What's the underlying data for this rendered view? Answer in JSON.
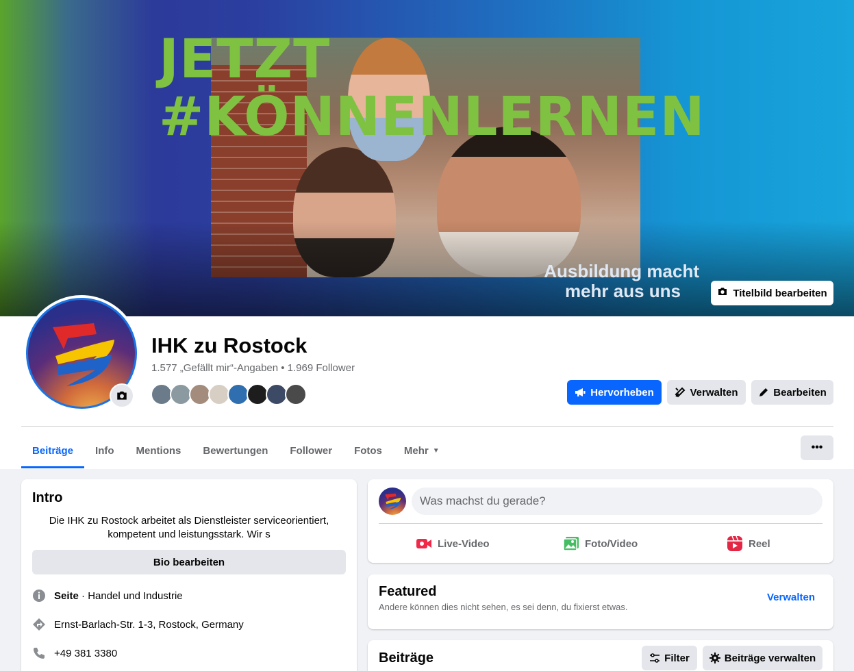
{
  "cover": {
    "headline_line1": "JETZT",
    "headline_line2": "#KÖNNENLERNEN",
    "tagline_line1": "Ausbildung macht",
    "tagline_line2": "mehr aus uns",
    "edit_button": "Titelbild bearbeiten"
  },
  "profile": {
    "name": "IHK zu Rostock",
    "stats": "1.577 „Gefällt mir“-Angaben • 1.969 Follower",
    "friend_colors": [
      "#6b7b8a",
      "#8a9aa0",
      "#a48c7c",
      "#d8cfc4",
      "#2f6fb0",
      "#1d1d1d",
      "#3c4a66",
      "#4a4a4a"
    ]
  },
  "actions": {
    "promote": "Hervorheben",
    "manage": "Verwalten",
    "edit": "Bearbeiten"
  },
  "tabs": [
    {
      "label": "Beiträge",
      "active": true
    },
    {
      "label": "Info"
    },
    {
      "label": "Mentions"
    },
    {
      "label": "Bewertungen"
    },
    {
      "label": "Follower"
    },
    {
      "label": "Fotos"
    },
    {
      "label": "Mehr"
    }
  ],
  "more_menu": "•••",
  "intro": {
    "title": "Intro",
    "bio": "Die IHK zu Rostock arbeitet als Dienstleister serviceorientiert, kompetent und leistungsstark. Wir s",
    "bio_button": "Bio bearbeiten",
    "category_bold": "Seite",
    "category_rest": " · Handel und Industrie",
    "address": "Ernst-Barlach-Str. 1-3, Rostock, Germany",
    "phone": "+49 381 3380"
  },
  "composer": {
    "placeholder": "Was machst du gerade?",
    "live": "Live-Video",
    "photo": "Foto/Video",
    "reel": "Reel"
  },
  "featured": {
    "title": "Featured",
    "subtitle": "Andere können dies nicht sehen, es sei denn, du fixierst etwas.",
    "manage": "Verwalten"
  },
  "posts": {
    "title": "Beiträge",
    "filter": "Filter",
    "manage": "Beiträge verwalten"
  },
  "colors": {
    "accent": "#0866ff",
    "headline_green": "#7fc241"
  }
}
